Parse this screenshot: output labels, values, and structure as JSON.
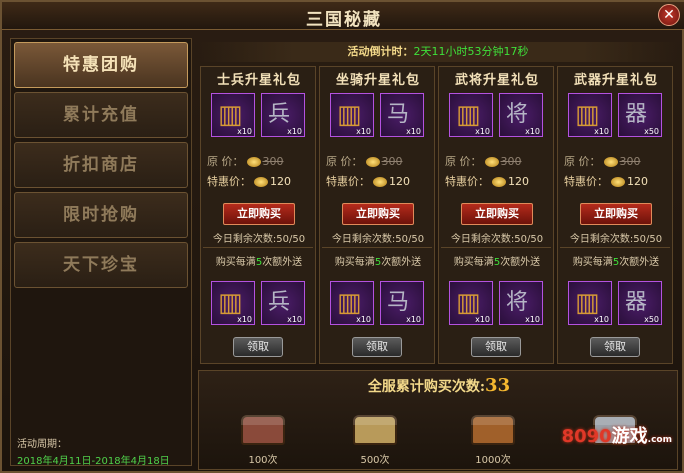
{
  "window": {
    "title": "三国秘藏",
    "close_glyph": "✕"
  },
  "sidebar": {
    "items": [
      {
        "label": "特惠团购",
        "active": true
      },
      {
        "label": "累计充值",
        "active": false
      },
      {
        "label": "折扣商店",
        "active": false
      },
      {
        "label": "限时抢购",
        "active": false
      },
      {
        "label": "天下珍宝",
        "active": false
      }
    ],
    "period_label": "活动周期：",
    "period_value": "2018年4月11日-2018年4月18日"
  },
  "countdown": {
    "label": "活动倒计时：",
    "value": "2天11小时53分钟17秒"
  },
  "packs": [
    {
      "title": "士兵升星礼包",
      "item1_count": "x10",
      "item2_count": "x10",
      "item2_glyph": "兵",
      "orig_label": "原   价：",
      "orig_price": "300",
      "sale_label": "特惠价：",
      "sale_price": "120",
      "buy_label": "立即购买",
      "remaining": "今日剩余次数:50/50",
      "bonus_pre": "购买每满",
      "bonus_num": "5",
      "bonus_post": "次额外送",
      "bonus_item1_count": "x10",
      "bonus_item2_count": "x10",
      "claim_label": "领取"
    },
    {
      "title": "坐骑升星礼包",
      "item1_count": "x10",
      "item2_count": "x10",
      "item2_glyph": "马",
      "orig_label": "原   价：",
      "orig_price": "300",
      "sale_label": "特惠价：",
      "sale_price": "120",
      "buy_label": "立即购买",
      "remaining": "今日剩余次数:50/50",
      "bonus_pre": "购买每满",
      "bonus_num": "5",
      "bonus_post": "次额外送",
      "bonus_item1_count": "x10",
      "bonus_item2_count": "x10",
      "claim_label": "领取"
    },
    {
      "title": "武将升星礼包",
      "item1_count": "x10",
      "item2_count": "x10",
      "item2_glyph": "将",
      "orig_label": "原   价：",
      "orig_price": "300",
      "sale_label": "特惠价：",
      "sale_price": "120",
      "buy_label": "立即购买",
      "remaining": "今日剩余次数:50/50",
      "bonus_pre": "购买每满",
      "bonus_num": "5",
      "bonus_post": "次额外送",
      "bonus_item1_count": "x10",
      "bonus_item2_count": "x10",
      "claim_label": "领取"
    },
    {
      "title": "武器升星礼包",
      "item1_count": "x10",
      "item2_count": "x50",
      "item2_glyph": "器",
      "orig_label": "原   价：",
      "orig_price": "300",
      "sale_label": "特惠价：",
      "sale_price": "120",
      "buy_label": "立即购买",
      "remaining": "今日剩余次数:50/50",
      "bonus_pre": "购买每满",
      "bonus_num": "5",
      "bonus_post": "次额外送",
      "bonus_item1_count": "x10",
      "bonus_item2_count": "x50",
      "claim_label": "领取"
    }
  ],
  "rewards": {
    "total_label": "全服累计购买次数:",
    "total_count": "33",
    "chests": [
      {
        "label": "100次",
        "color": "#8a4a3a"
      },
      {
        "label": "500次",
        "color": "#b89a5a"
      },
      {
        "label": "1000次",
        "color": "#a0602a"
      },
      {
        "label": "",
        "color": "#9aa0a8"
      }
    ]
  },
  "watermark": {
    "num": "8090",
    "text": "游戏",
    "sub": ".com"
  }
}
